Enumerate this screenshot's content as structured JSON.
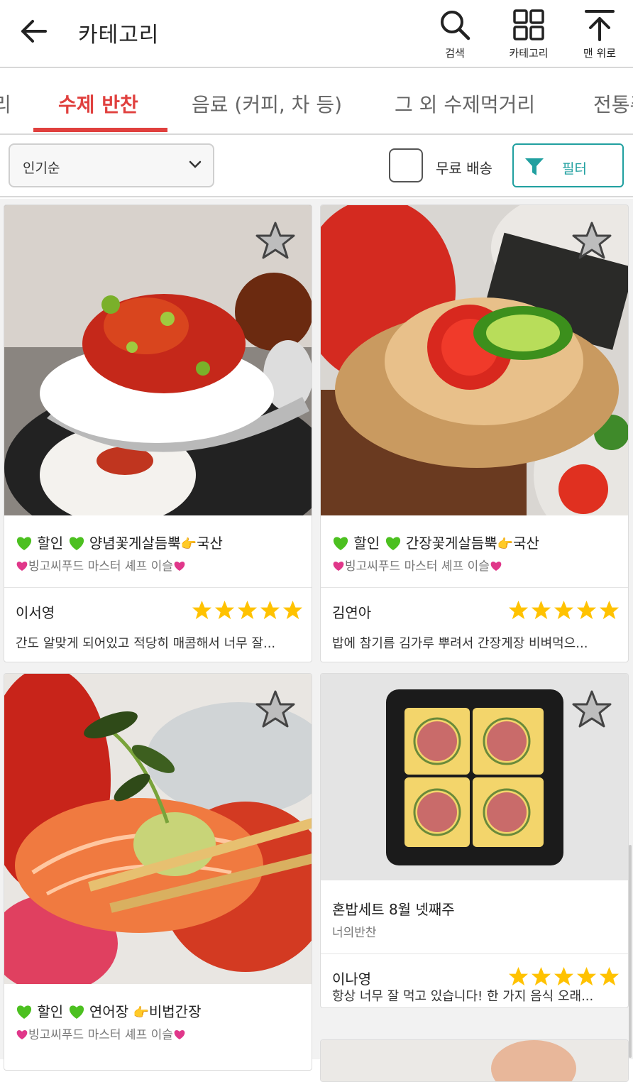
{
  "header": {
    "title": "카테고리",
    "search_label": "검색",
    "category_label": "카테고리",
    "top_label": "맨 위로"
  },
  "tabs": [
    {
      "label": "리"
    },
    {
      "label": "수제 반찬"
    },
    {
      "label": "음료 (커피, 차 등)"
    },
    {
      "label": "그 외 수제먹거리"
    },
    {
      "label": "전통주"
    }
  ],
  "filters": {
    "sort_value": "인기순",
    "free_shipping_label": "무료 배송",
    "free_shipping_checked": false,
    "filter_label": "필터"
  },
  "products": [
    {
      "name_a": "할인",
      "name_b": "양념꽃게살듬뿍",
      "name_c": "국산",
      "seller": "빙고씨푸드 마스터 셰프 이슬",
      "reviewer": "이서영",
      "rating": 5,
      "review": "간도 알맞게 되어있고 적당히 매콤해서 너무 잘..."
    },
    {
      "name_a": "할인",
      "name_b": "간장꽃게살듬뿍",
      "name_c": "국산",
      "seller": "빙고씨푸드 마스터 셰프 이슬",
      "reviewer": "김연아",
      "rating": 5,
      "review": "밥에 참기름 김가루 뿌려서 간장게장 비벼먹으..."
    },
    {
      "name_a": "할인",
      "name_b": "연어장",
      "name_c": "비법간장",
      "seller": "빙고씨푸드 마스터 셰프 이슬"
    },
    {
      "name": "혼밥세트 8월 넷째주",
      "seller": "너의반찬",
      "reviewer": "이나영",
      "rating": 5,
      "review": "항상 너무 잘 먹고 있습니다! 한 가지 음식 오래..."
    }
  ],
  "colors": {
    "accent_red": "#e0403e",
    "filter_teal": "#21a0a0",
    "rating_star": "#ffc200"
  }
}
